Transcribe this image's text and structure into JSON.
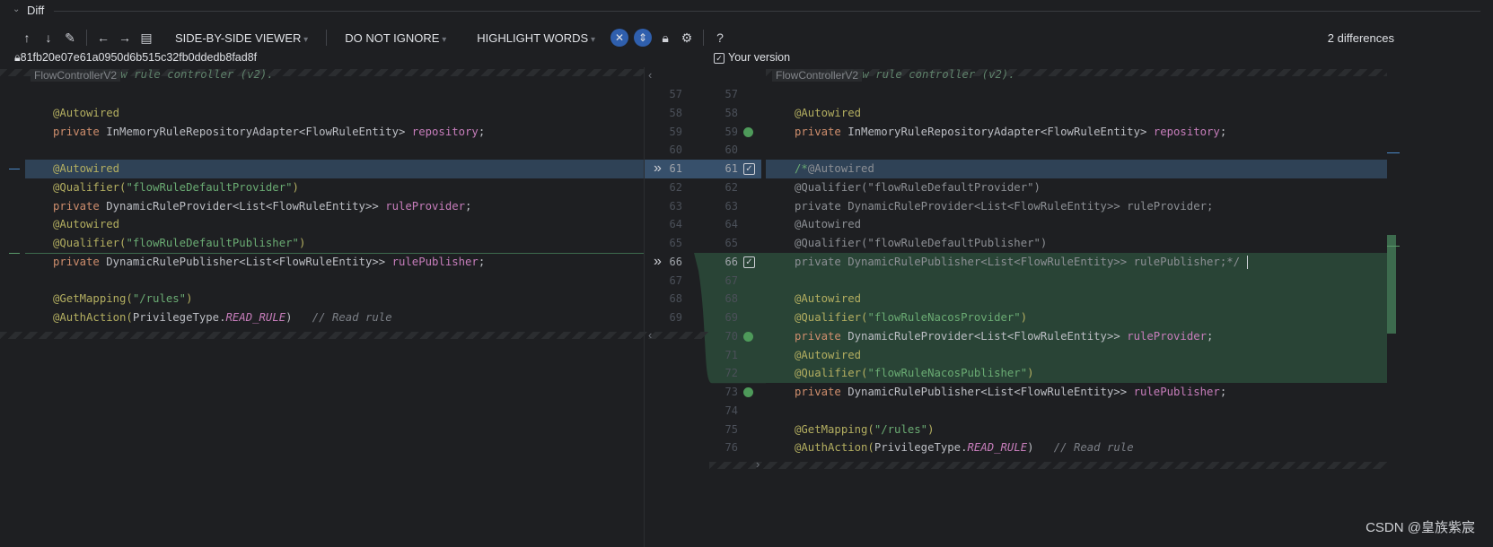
{
  "panel": {
    "title": "Diff"
  },
  "toolbar": {
    "viewer": "SIDE-BY-SIDE VIEWER",
    "ignore": "DO NOT IGNORE",
    "highlight": "HIGHLIGHT WORDS",
    "help": "?",
    "differences": "2 differences"
  },
  "left": {
    "revision": "81fb20e07e61a0950d6b515c32fb0ddedb8fad8f",
    "breadcrumb": "FlowControllerV2",
    "top_comment": "// Flow rule controller (v2).",
    "lines": [
      {
        "n": 57,
        "t": []
      },
      {
        "n": 58,
        "t": [
          [
            "an",
            "@Autowired"
          ]
        ]
      },
      {
        "n": 59,
        "t": [
          [
            "kw",
            "private "
          ],
          [
            "ty",
            "InMemoryRuleRepositoryAdapter<FlowRuleEntity> "
          ],
          [
            "fd",
            "repository"
          ],
          [
            "ty",
            ";"
          ]
        ]
      },
      {
        "n": 60,
        "t": []
      },
      {
        "n": 61,
        "t": [
          [
            "an",
            "@Autowired"
          ]
        ]
      },
      {
        "n": 62,
        "t": [
          [
            "an",
            "@Qualifier("
          ],
          [
            "st",
            "\"flowRuleDefaultProvider\""
          ],
          [
            "an",
            ")"
          ]
        ]
      },
      {
        "n": 63,
        "t": [
          [
            "kw",
            "private "
          ],
          [
            "ty",
            "DynamicRuleProvider<List<FlowRuleEntity>> "
          ],
          [
            "fd",
            "ruleProvider"
          ],
          [
            "ty",
            ";"
          ]
        ]
      },
      {
        "n": 64,
        "t": [
          [
            "an",
            "@Autowired"
          ]
        ]
      },
      {
        "n": 65,
        "t": [
          [
            "an",
            "@Qualifier("
          ],
          [
            "st",
            "\"flowRuleDefaultPublisher\""
          ],
          [
            "an",
            ")"
          ]
        ]
      },
      {
        "n": 66,
        "t": [
          [
            "kw",
            "private "
          ],
          [
            "ty",
            "DynamicRulePublisher<List<FlowRuleEntity>> "
          ],
          [
            "fd",
            "rulePublisher"
          ],
          [
            "ty",
            ";"
          ]
        ]
      },
      {
        "n": 67,
        "t": []
      },
      {
        "n": 68,
        "t": [
          [
            "an",
            "@GetMapping("
          ],
          [
            "st",
            "\"/rules\""
          ],
          [
            "an",
            ")"
          ]
        ]
      },
      {
        "n": 69,
        "t": [
          [
            "an",
            "@AuthAction("
          ],
          [
            "ty",
            "PrivilegeType."
          ],
          [
            "cn",
            "READ_RULE"
          ],
          [
            "ty",
            ")   "
          ],
          [
            "cm",
            "// Read rule"
          ]
        ]
      }
    ]
  },
  "right": {
    "version_label": "Your version",
    "breadcrumb": "FlowControllerV2",
    "top_comment": "// Flow rule controller (v2).",
    "lines": [
      {
        "n": 57,
        "t": []
      },
      {
        "n": 58,
        "t": [
          [
            "an",
            "@Autowired"
          ]
        ]
      },
      {
        "n": 59,
        "t": [
          [
            "kw",
            "private "
          ],
          [
            "ty",
            "InMemoryRuleRepositoryAdapter<FlowRuleEntity> "
          ],
          [
            "fd",
            "repository"
          ],
          [
            "ty",
            ";"
          ]
        ]
      },
      {
        "n": 60,
        "t": []
      },
      {
        "n": 61,
        "t": [
          [
            "st",
            "/*"
          ],
          [
            "gr",
            "@Autowired"
          ]
        ]
      },
      {
        "n": 62,
        "t": [
          [
            "gr",
            "@Qualifier(\"flowRuleDefaultProvider\")"
          ]
        ]
      },
      {
        "n": 63,
        "t": [
          [
            "gr",
            "private DynamicRuleProvider<List<FlowRuleEntity>> ruleProvider;"
          ]
        ]
      },
      {
        "n": 64,
        "t": [
          [
            "gr",
            "@Autowired"
          ]
        ]
      },
      {
        "n": 65,
        "t": [
          [
            "gr",
            "@Qualifier(\"flowRuleDefaultPublisher\")"
          ]
        ]
      },
      {
        "n": 66,
        "t": [
          [
            "gr",
            "private DynamicRulePublisher<List<FlowRuleEntity>> rulePublisher;*/"
          ]
        ]
      },
      {
        "n": 67,
        "t": []
      },
      {
        "n": 68,
        "t": [
          [
            "an",
            "@Autowired"
          ]
        ]
      },
      {
        "n": 69,
        "t": [
          [
            "an",
            "@Qualifier("
          ],
          [
            "st",
            "\"flowRuleNacosProvider\""
          ],
          [
            "an",
            ")"
          ]
        ]
      },
      {
        "n": 70,
        "t": [
          [
            "kw",
            "private "
          ],
          [
            "ty",
            "DynamicRuleProvider<List<FlowRuleEntity>> "
          ],
          [
            "fd",
            "ruleProvider"
          ],
          [
            "ty",
            ";"
          ]
        ]
      },
      {
        "n": 71,
        "t": [
          [
            "an",
            "@Autowired"
          ]
        ]
      },
      {
        "n": 72,
        "t": [
          [
            "an",
            "@Qualifier("
          ],
          [
            "st",
            "\"flowRuleNacosPublisher\""
          ],
          [
            "an",
            ")"
          ]
        ]
      },
      {
        "n": 73,
        "t": [
          [
            "kw",
            "private "
          ],
          [
            "ty",
            "DynamicRulePublisher<List<FlowRuleEntity>> "
          ],
          [
            "fd",
            "rulePublisher"
          ],
          [
            "ty",
            ";"
          ]
        ]
      },
      {
        "n": 74,
        "t": []
      },
      {
        "n": 75,
        "t": [
          [
            "an",
            "@GetMapping("
          ],
          [
            "st",
            "\"/rules\""
          ],
          [
            "an",
            ")"
          ]
        ]
      },
      {
        "n": 76,
        "t": [
          [
            "an",
            "@AuthAction("
          ],
          [
            "ty",
            "PrivilegeType."
          ],
          [
            "cn",
            "READ_RULE"
          ],
          [
            "ty",
            ")   "
          ],
          [
            "cm",
            "// Read rule"
          ]
        ]
      }
    ]
  },
  "watermark": "CSDN @皇族紫宸",
  "colors": {
    "changed": "#2f4256",
    "inserted": "#294436"
  }
}
